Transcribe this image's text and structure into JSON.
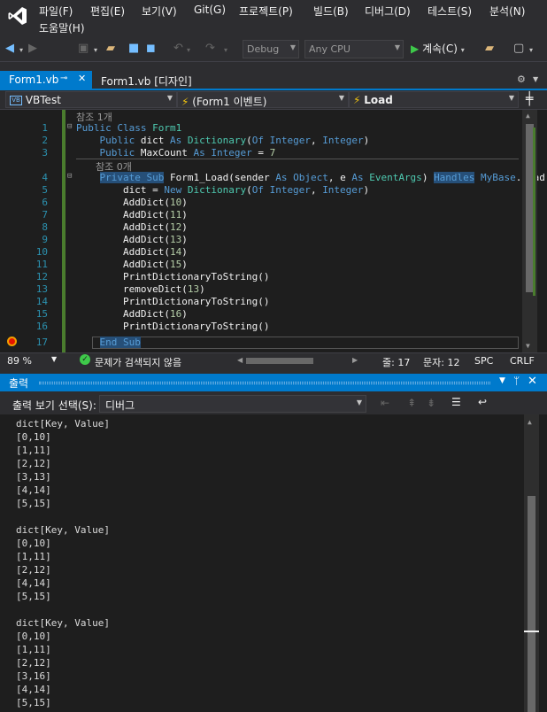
{
  "menu": {
    "items": [
      "파일(F)",
      "편집(E)",
      "보기(V)",
      "Git(G)",
      "프로젝트(P)",
      "빌드(B)",
      "디버그(D)",
      "테스트(S)",
      "분석(N)",
      "도움말(H)"
    ]
  },
  "toolbar": {
    "config": "Debug",
    "platform": "Any CPU",
    "continue_label": "계속(C)"
  },
  "tabs": [
    {
      "label": "Form1.vb",
      "active": true
    },
    {
      "label": "Form1.vb [디자인]",
      "active": false
    }
  ],
  "navbar": {
    "project": "VBTest",
    "object": "(Form1 이벤트)",
    "member": "Load"
  },
  "editor": {
    "lens_top": "참조 1개",
    "lens_mid": "참조 0개",
    "lines": [
      {
        "n": "1",
        "parts": [
          {
            "t": "Public Class ",
            "c": "kw"
          },
          {
            "t": "Form1",
            "c": "ty"
          }
        ]
      },
      {
        "n": "2",
        "parts": [
          {
            "t": "    Public ",
            "c": "kw"
          },
          {
            "t": "dict ",
            "c": ""
          },
          {
            "t": "As ",
            "c": "kw"
          },
          {
            "t": "Dictionary",
            "c": "ty"
          },
          {
            "t": "(",
            "c": ""
          },
          {
            "t": "Of Integer",
            "c": "kw"
          },
          {
            "t": ", ",
            "c": ""
          },
          {
            "t": "Integer",
            "c": "kw"
          },
          {
            "t": ")",
            "c": ""
          }
        ]
      },
      {
        "n": "3",
        "parts": [
          {
            "t": "    Public ",
            "c": "kw"
          },
          {
            "t": "MaxCount ",
            "c": ""
          },
          {
            "t": "As Integer ",
            "c": "kw"
          },
          {
            "t": "= ",
            "c": ""
          },
          {
            "t": "7",
            "c": "nm"
          }
        ]
      },
      {
        "n": "4",
        "parts": [
          {
            "t": "    ",
            "c": ""
          },
          {
            "t": "Private Sub",
            "c": "kw hl"
          },
          {
            "t": " Form1_Load(sender ",
            "c": ""
          },
          {
            "t": "As ",
            "c": "kw"
          },
          {
            "t": "Object",
            "c": "kw"
          },
          {
            "t": ", e ",
            "c": ""
          },
          {
            "t": "As ",
            "c": "kw"
          },
          {
            "t": "EventArgs",
            "c": "ty"
          },
          {
            "t": ") ",
            "c": ""
          },
          {
            "t": "Handles",
            "c": "kw hl"
          },
          {
            "t": " ",
            "c": ""
          },
          {
            "t": "MyBase",
            "c": "kw"
          },
          {
            "t": ".Load",
            "c": ""
          }
        ]
      },
      {
        "n": "5",
        "parts": [
          {
            "t": "        dict = ",
            "c": ""
          },
          {
            "t": "New ",
            "c": "kw"
          },
          {
            "t": "Dictionary",
            "c": "ty"
          },
          {
            "t": "(",
            "c": ""
          },
          {
            "t": "Of Integer",
            "c": "kw"
          },
          {
            "t": ", ",
            "c": ""
          },
          {
            "t": "Integer",
            "c": "kw"
          },
          {
            "t": ")",
            "c": ""
          }
        ]
      },
      {
        "n": "6",
        "parts": [
          {
            "t": "        AddDict(",
            "c": ""
          },
          {
            "t": "10",
            "c": "nm"
          },
          {
            "t": ")",
            "c": ""
          }
        ]
      },
      {
        "n": "7",
        "parts": [
          {
            "t": "        AddDict(",
            "c": ""
          },
          {
            "t": "11",
            "c": "nm"
          },
          {
            "t": ")",
            "c": ""
          }
        ]
      },
      {
        "n": "8",
        "parts": [
          {
            "t": "        AddDict(",
            "c": ""
          },
          {
            "t": "12",
            "c": "nm"
          },
          {
            "t": ")",
            "c": ""
          }
        ]
      },
      {
        "n": "9",
        "parts": [
          {
            "t": "        AddDict(",
            "c": ""
          },
          {
            "t": "13",
            "c": "nm"
          },
          {
            "t": ")",
            "c": ""
          }
        ]
      },
      {
        "n": "10",
        "parts": [
          {
            "t": "        AddDict(",
            "c": ""
          },
          {
            "t": "14",
            "c": "nm"
          },
          {
            "t": ")",
            "c": ""
          }
        ]
      },
      {
        "n": "11",
        "parts": [
          {
            "t": "        AddDict(",
            "c": ""
          },
          {
            "t": "15",
            "c": "nm"
          },
          {
            "t": ")",
            "c": ""
          }
        ]
      },
      {
        "n": "12",
        "parts": [
          {
            "t": "        PrintDictionaryToString()",
            "c": ""
          }
        ]
      },
      {
        "n": "13",
        "parts": [
          {
            "t": "        removeDict(",
            "c": ""
          },
          {
            "t": "13",
            "c": "nm"
          },
          {
            "t": ")",
            "c": ""
          }
        ]
      },
      {
        "n": "14",
        "parts": [
          {
            "t": "        PrintDictionaryToString()",
            "c": ""
          }
        ]
      },
      {
        "n": "15",
        "parts": [
          {
            "t": "        AddDict(",
            "c": ""
          },
          {
            "t": "16",
            "c": "nm"
          },
          {
            "t": ")",
            "c": ""
          }
        ]
      },
      {
        "n": "16",
        "parts": [
          {
            "t": "        PrintDictionaryToString()",
            "c": ""
          }
        ]
      },
      {
        "n": "17",
        "parts": [
          {
            "t": "    ",
            "c": ""
          },
          {
            "t": "End Sub",
            "c": "kw hl"
          }
        ]
      }
    ]
  },
  "status": {
    "zoom": "89 %",
    "issues": "문제가 검색되지 않음",
    "line": "줄: 17",
    "col": "문자: 12",
    "spc": "SPC",
    "crlf": "CRLF"
  },
  "output": {
    "title": "출력",
    "source_label": "출력 보기 선택(S):",
    "source_value": "디버그",
    "lines": [
      "dict[Key, Value]",
      "[0,10]",
      "[1,11]",
      "[2,12]",
      "[3,13]",
      "[4,14]",
      "[5,15]",
      "",
      "dict[Key, Value]",
      "[0,10]",
      "[1,11]",
      "[2,12]",
      "[4,14]",
      "[5,15]",
      "",
      "dict[Key, Value]",
      "[0,10]",
      "[1,11]",
      "[2,12]",
      "[3,16]",
      "[4,14]",
      "[5,15]"
    ]
  }
}
